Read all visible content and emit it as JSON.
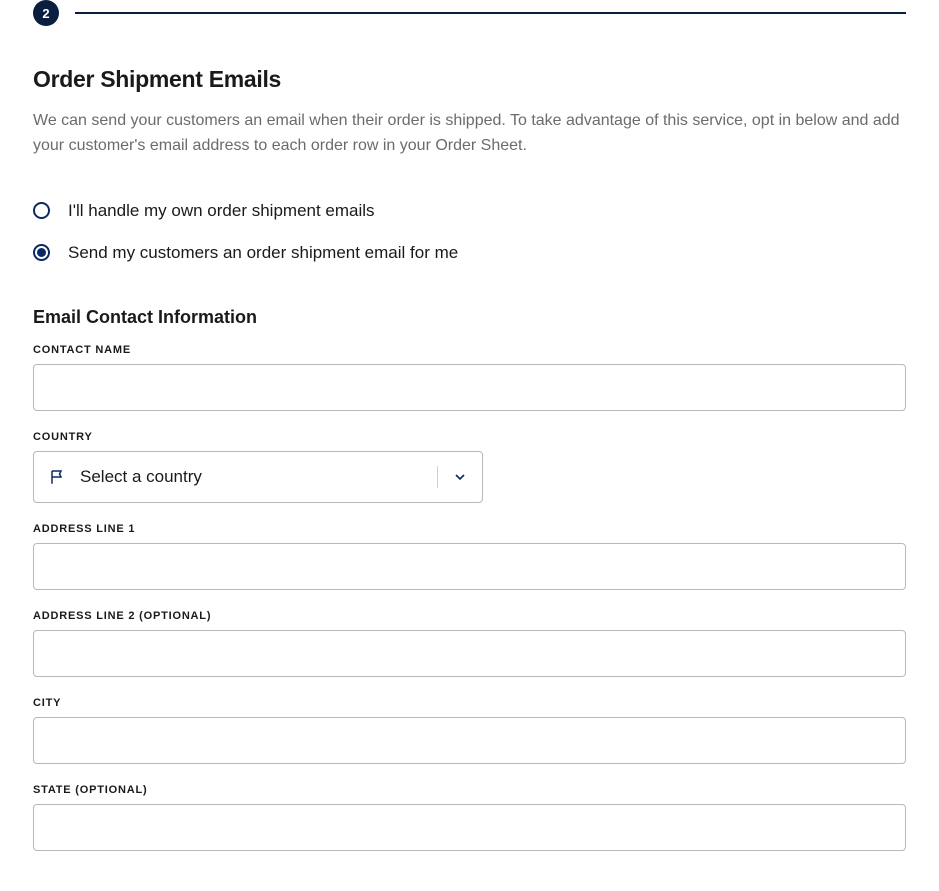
{
  "step": "2",
  "section": {
    "title": "Order Shipment Emails",
    "description": "We can send your customers an email when their order is shipped. To take advantage of this service, opt in below and add your customer's email address to each order row in your Order Sheet."
  },
  "radios": {
    "option1": {
      "label": "I'll handle my own order shipment emails",
      "selected": false
    },
    "option2": {
      "label": "Send my customers an order shipment email for me",
      "selected": true
    }
  },
  "subheading": "Email Contact Information",
  "fields": {
    "contactName": {
      "label": "CONTACT NAME",
      "value": ""
    },
    "country": {
      "label": "COUNTRY",
      "placeholder": "Select a country"
    },
    "address1": {
      "label": "ADDRESS LINE 1",
      "value": ""
    },
    "address2": {
      "label": "ADDRESS LINE 2 (OPTIONAL)",
      "value": ""
    },
    "city": {
      "label": "CITY",
      "value": ""
    },
    "state": {
      "label": "STATE (OPTIONAL)",
      "value": ""
    }
  }
}
